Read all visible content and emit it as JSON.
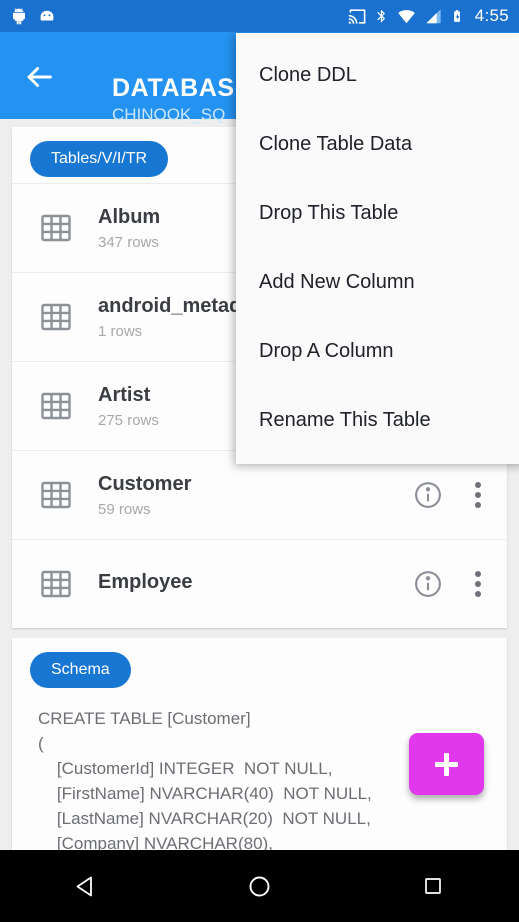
{
  "status_bar": {
    "notification_icons": [
      "android-robot-icon",
      "android-head-icon"
    ],
    "system_icons": [
      "cast-icon",
      "bluetooth-icon",
      "wifi-icon",
      "signal-icon",
      "battery-charging-icon"
    ],
    "time": "4:55",
    "background_color": "#1b71cf"
  },
  "app_bar": {
    "back_label": "back-arrow",
    "title": "DATABAS",
    "subtitle": "CHINOOK_SQ",
    "background_color": "#2492f0",
    "subtitle_color": "#c9e6fb"
  },
  "tables_section": {
    "chip_label": "Tables/V/I/TR",
    "chip_color": "#1777d2",
    "rows": [
      {
        "name": "Album",
        "rows_label": "347 rows"
      },
      {
        "name": "android_metada",
        "rows_label": "1 rows"
      },
      {
        "name": "Artist",
        "rows_label": "275 rows"
      },
      {
        "name": "Customer",
        "rows_label": "59 rows"
      },
      {
        "name": "Employee",
        "rows_label": ""
      }
    ]
  },
  "schema_section": {
    "chip_label": "Schema",
    "chip_color": "#1777d2",
    "code": "CREATE TABLE [Customer]\n(\n    [CustomerId] INTEGER  NOT NULL,\n    [FirstName] NVARCHAR(40)  NOT NULL,\n    [LastName] NVARCHAR(20)  NOT NULL,\n    [Company] NVARCHAR(80),"
  },
  "fab": {
    "label": "+",
    "color": "#e238ed"
  },
  "popup_menu": {
    "items": [
      "Clone DDL",
      "Clone Table Data",
      "Drop This Table",
      "Add New Column",
      "Drop A Column",
      "Rename This Table"
    ],
    "background_color": "#fafafa"
  },
  "nav_bar": {
    "buttons": [
      "back-triangle-icon",
      "home-circle-icon",
      "recents-square-icon"
    ],
    "background_color": "#000000"
  }
}
